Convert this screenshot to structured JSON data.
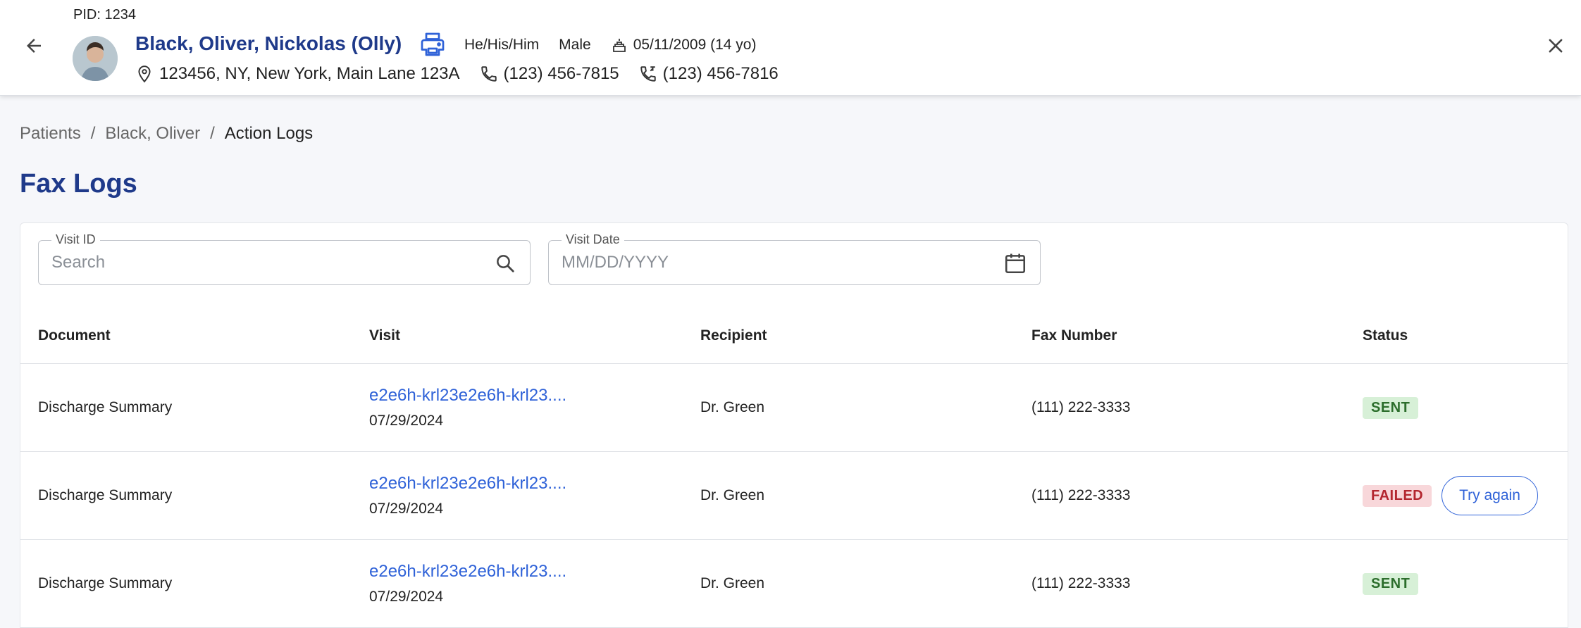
{
  "header": {
    "pid": "PID: 1234",
    "patient_name": "Black, Oliver, Nickolas (Olly)",
    "pronouns": "He/His/Him",
    "sex": "Male",
    "dob": "05/11/2009 (14 yo)",
    "address": "123456, NY, New York, Main Lane 123A",
    "phone": "(123) 456-7815",
    "fax": "(123) 456-7816"
  },
  "breadcrumb": {
    "items": [
      "Patients",
      "Black, Oliver",
      "Action Logs"
    ]
  },
  "page": {
    "title": "Fax Logs"
  },
  "filters": {
    "visit_id_label": "Visit ID",
    "visit_id_placeholder": "Search",
    "visit_date_label": "Visit Date",
    "visit_date_placeholder": "MM/DD/YYYY"
  },
  "table": {
    "columns": [
      "Document",
      "Visit",
      "Recipient",
      "Fax Number",
      "Status"
    ],
    "rows": [
      {
        "document": "Discharge Summary",
        "visit_id": "e2e6h-krl23e2e6h-krl23....",
        "visit_date": "07/29/2024",
        "recipient": "Dr. Green",
        "fax_number": "(111) 222-3333",
        "status": "SENT"
      },
      {
        "document": "Discharge Summary",
        "visit_id": "e2e6h-krl23e2e6h-krl23....",
        "visit_date": "07/29/2024",
        "recipient": "Dr. Green",
        "fax_number": "(111) 222-3333",
        "status": "FAILED",
        "action": "Try again"
      },
      {
        "document": "Discharge Summary",
        "visit_id": "e2e6h-krl23e2e6h-krl23....",
        "visit_date": "07/29/2024",
        "recipient": "Dr. Green",
        "fax_number": "(111) 222-3333",
        "status": "SENT"
      }
    ]
  },
  "colors": {
    "primary": "#1f3a8a",
    "link": "#2f62d8",
    "sent_bg": "#d7f0d7",
    "sent_text": "#2c6e2c",
    "failed_bg": "#f8d7da",
    "failed_text": "#b3262f"
  },
  "icons": [
    "arrow-left-icon",
    "printer-icon",
    "cake-icon",
    "location-pin-icon",
    "phone-icon",
    "fax-phone-icon",
    "close-icon",
    "search-icon",
    "calendar-icon"
  ]
}
